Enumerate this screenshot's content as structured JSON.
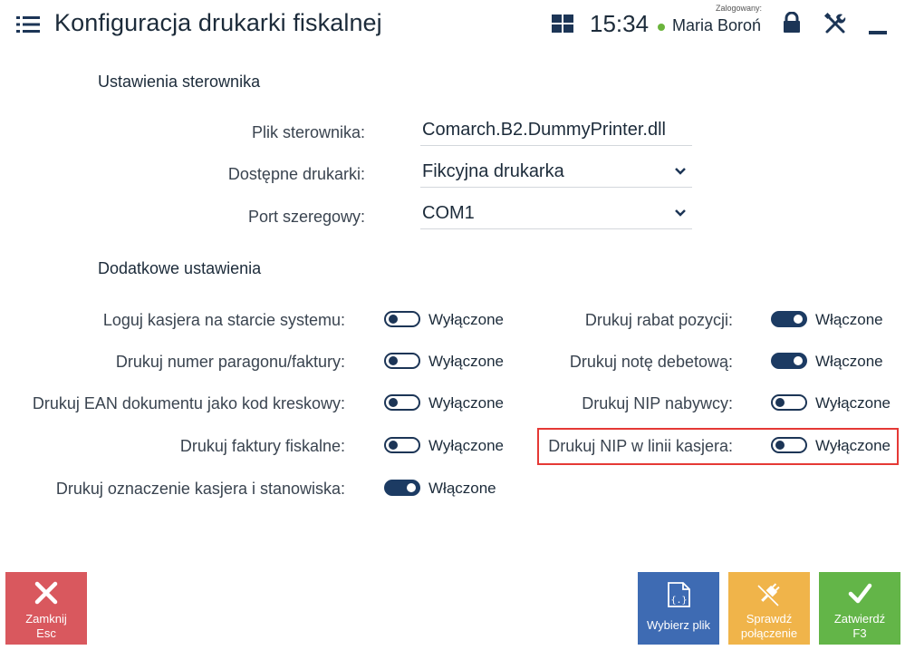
{
  "header": {
    "title": "Konfiguracja drukarki fiskalnej",
    "time": "15:34",
    "logged_caption": "Zalogowany:",
    "user": "Maria Boroń"
  },
  "driver_section": {
    "title": "Ustawienia sterownika",
    "fields": [
      {
        "label": "Plik sterownika:",
        "value": "Comarch.B2.DummyPrinter.dll"
      },
      {
        "label": "Dostępne drukarki:",
        "value": "Fikcyjna drukarka"
      },
      {
        "label": "Port szeregowy:",
        "value": "COM1"
      }
    ]
  },
  "extra_section": {
    "title": "Dodatkowe ustawienia",
    "left": [
      {
        "label": "Loguj kasjera na starcie systemu:",
        "state": "Wyłączone"
      },
      {
        "label": "Drukuj numer paragonu/faktury:",
        "state": "Wyłączone"
      },
      {
        "label": "Drukuj EAN dokumentu jako kod kreskowy:",
        "state": "Wyłączone"
      },
      {
        "label": "Drukuj faktury fiskalne:",
        "state": "Wyłączone"
      },
      {
        "label": "Drukuj oznaczenie kasjera i stanowiska:",
        "state": "Włączone"
      }
    ],
    "right": [
      {
        "label": "Drukuj rabat pozycji:",
        "state": "Włączone"
      },
      {
        "label": "Drukuj notę debetową:",
        "state": "Włączone"
      },
      {
        "label": "Drukuj NIP nabywcy:",
        "state": "Wyłączone"
      },
      {
        "label": "Drukuj NIP w linii kasjera:",
        "state": "Wyłączone"
      }
    ]
  },
  "buttons": {
    "close_line1": "Zamknij",
    "close_line2": "Esc",
    "file": "Wybierz plik",
    "check_line1": "Sprawdź",
    "check_line2": "połączenie",
    "ok_line1": "Zatwierdź",
    "ok_line2": "F3"
  },
  "colors": {
    "toggle_on": "#1c3b63",
    "close": "#d9585e",
    "file": "#3e6bb3",
    "check": "#f0b44a",
    "ok": "#63b548",
    "highlight": "#e53935"
  }
}
